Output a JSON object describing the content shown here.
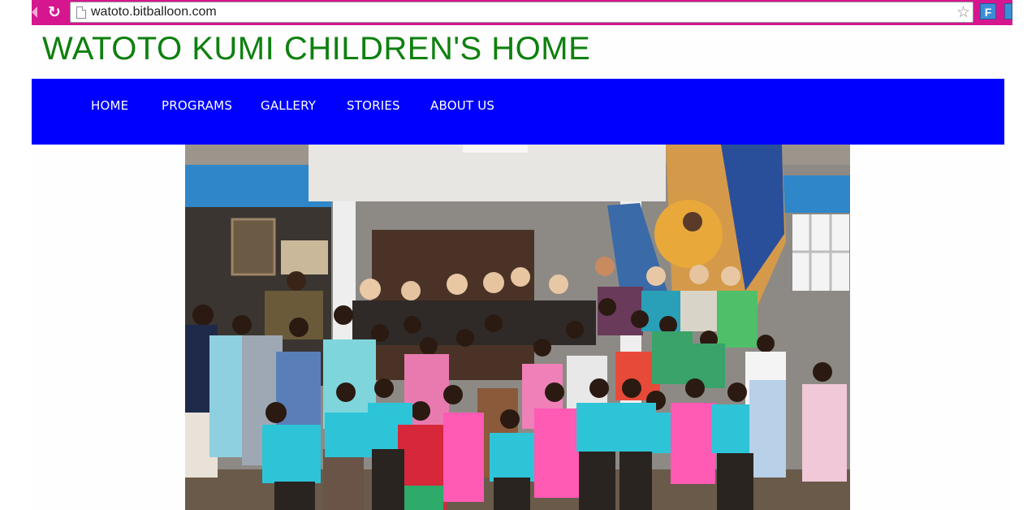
{
  "browser": {
    "url": "watoto.bitballoon.com",
    "extension_label": "F"
  },
  "site": {
    "title": "WATOTO KUMI CHILDREN'S HOME"
  },
  "nav": {
    "items": [
      {
        "label": "HOME"
      },
      {
        "label": "PROGRAMS"
      },
      {
        "label": "GALLERY"
      },
      {
        "label": "STORIES"
      },
      {
        "label": "ABOUT US"
      }
    ]
  },
  "hero": {
    "subject": "group-photo"
  },
  "colors": {
    "browser_frame": "#d6168f",
    "title": "#0e800e",
    "nav_background": "#0000ff",
    "nav_text": "#ffffff"
  }
}
